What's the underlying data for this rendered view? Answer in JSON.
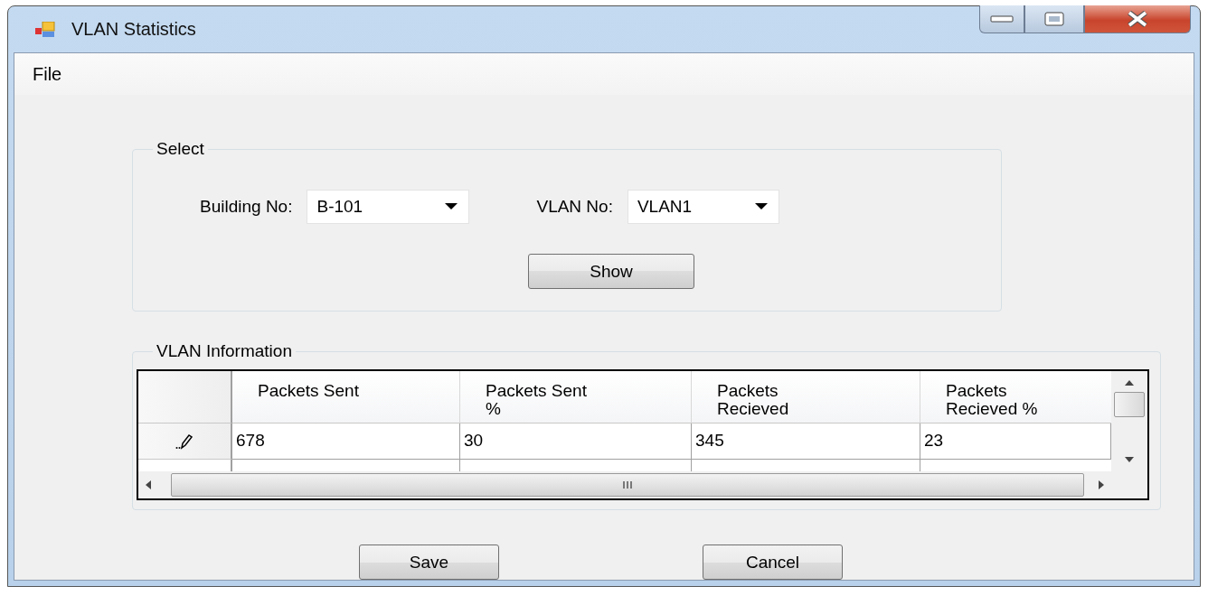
{
  "window": {
    "title": "VLAN Statistics"
  },
  "menu": [
    "File"
  ],
  "select_group": {
    "title": "Select",
    "building_label": "Building No:",
    "building_value": "B-101",
    "vlan_label": "VLAN No:",
    "vlan_value": "VLAN1",
    "show_button": "Show"
  },
  "info_group": {
    "title": "VLAN Information"
  },
  "table": {
    "columns": [
      "Packets Sent",
      "Packets Sent\n%",
      "Packets\nRecieved",
      "Packets\nRecieved %"
    ],
    "rows": [
      {
        "editing": true,
        "cells": [
          "678",
          "30",
          "345",
          "23"
        ]
      }
    ]
  },
  "buttons": [
    "Save",
    "Cancel"
  ]
}
